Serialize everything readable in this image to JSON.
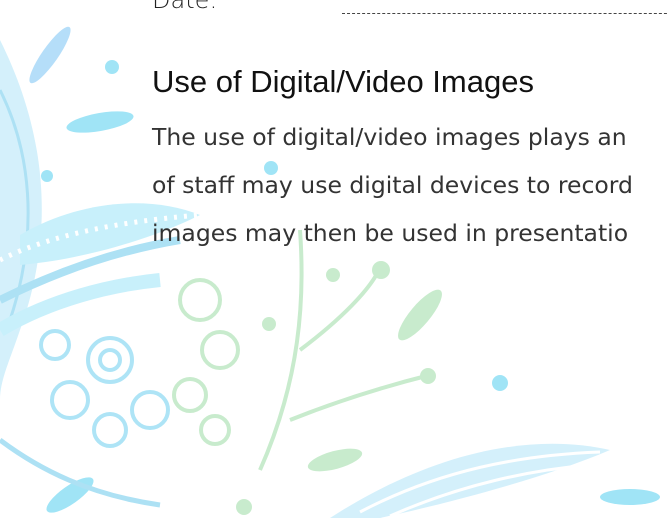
{
  "date_field": {
    "label": "Date:"
  },
  "section": {
    "heading": "Use of Digital/Video Images",
    "lines": [
      "The use of digital/video images plays an",
      "of staff may use digital devices to record",
      "images may then be used in presentatio"
    ]
  },
  "colors": {
    "text": "#333333",
    "heading": "#111111",
    "floral_blue": "#8fe0f5",
    "floral_green": "#b8e8b8"
  }
}
